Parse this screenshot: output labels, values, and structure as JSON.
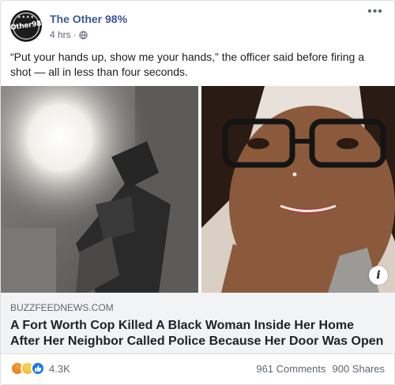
{
  "page": {
    "name": "The Other 98%",
    "logo_text": "Other98",
    "time": "4 hrs",
    "separator": "·"
  },
  "icons": {
    "more": "more-options-icon",
    "privacy": "globe-icon",
    "info": "info-icon",
    "reactions": [
      "angry-reaction-icon",
      "sad-reaction-icon",
      "like-reaction-icon"
    ]
  },
  "post": {
    "text": "“Put your hands up, show me your hands,” the officer said before firing a shot — all in less than four seconds."
  },
  "link": {
    "domain": "BUZZFEEDNEWS.COM",
    "title": "A Fort Worth Cop Killed A Black Woman Inside Her Home After Her Neighbor Called Police Because Her Door Was Open",
    "info_glyph": "i"
  },
  "footer": {
    "reaction_count": "4.3K",
    "comments": "961 Comments",
    "shares": "900 Shares"
  },
  "colors": {
    "page_name": "#385898",
    "angry": "#e9710f",
    "sad": "#f7b125",
    "like": "#1877f2",
    "link_bg": "#f2f3f5"
  }
}
